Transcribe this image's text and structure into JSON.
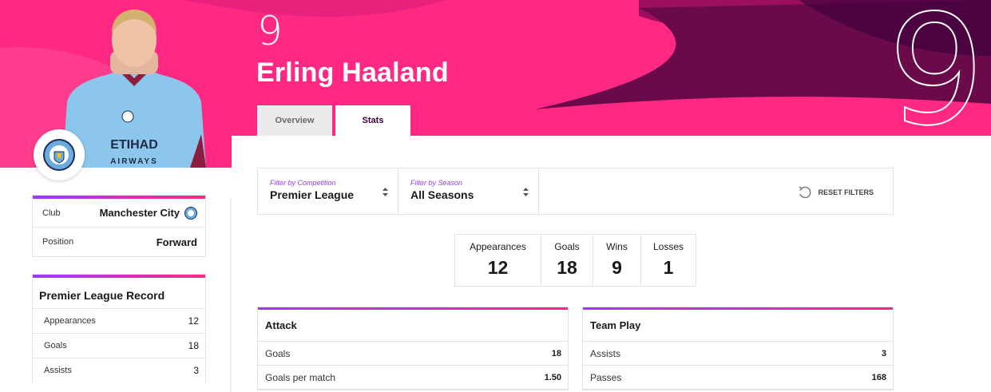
{
  "player": {
    "number": "9",
    "name": "Erling Haaland",
    "big_number": "9"
  },
  "colors": {
    "hero": "#ff2882",
    "hero_dark": "#37003c",
    "accent_purple": "#963cff"
  },
  "tabs": [
    {
      "label": "Overview",
      "active": false
    },
    {
      "label": "Stats",
      "active": true
    }
  ],
  "sidebar": {
    "club_label": "Club",
    "club_value": "Manchester City",
    "position_label": "Position",
    "position_value": "Forward",
    "record_title": "Premier League Record",
    "record_rows": [
      {
        "label": "Appearances",
        "value": "12"
      },
      {
        "label": "Goals",
        "value": "18"
      },
      {
        "label": "Assists",
        "value": "3"
      }
    ]
  },
  "filters": {
    "competition_label": "Filter by Competition",
    "competition_value": "Premier League",
    "season_label": "Filter by Season",
    "season_value": "All Seasons",
    "reset_label": "RESET FILTERS"
  },
  "summary": [
    {
      "label": "Appearances",
      "value": "12"
    },
    {
      "label": "Goals",
      "value": "18"
    },
    {
      "label": "Wins",
      "value": "9"
    },
    {
      "label": "Losses",
      "value": "1"
    }
  ],
  "attack": {
    "title": "Attack",
    "rows": [
      {
        "label": "Goals",
        "value": "18"
      },
      {
        "label": "Goals per match",
        "value": "1.50"
      }
    ]
  },
  "team_play": {
    "title": "Team Play",
    "rows": [
      {
        "label": "Assists",
        "value": "3"
      },
      {
        "label": "Passes",
        "value": "168"
      }
    ]
  },
  "icons": {
    "club_badge": "manchester-city-badge-icon",
    "sort": "sort-icon",
    "reset": "reset-icon"
  }
}
